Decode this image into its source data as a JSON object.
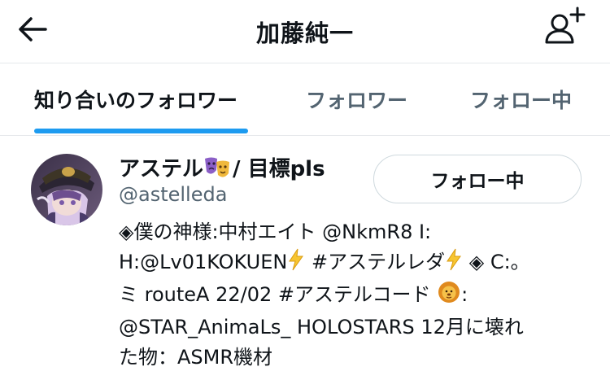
{
  "header": {
    "title": "加藤純一",
    "back_icon": "arrow-left-icon",
    "add_icon": "add-user-icon"
  },
  "tabs": [
    {
      "label": "知り合いのフォロワー",
      "active": true
    },
    {
      "label": "フォロワー",
      "active": false
    },
    {
      "label": "フォロー中",
      "active": false
    }
  ],
  "colors": {
    "accent": "#1d9bf0",
    "text_primary": "#0f1419",
    "text_secondary": "#536471",
    "divider": "#e6e9ec"
  },
  "user": {
    "name_prefix": "アステル",
    "name_suffix": " / 目標pls",
    "handle": "@astelleda",
    "follow_label": "フォロー中",
    "bio_lines": [
      "◈僕の神様:中村エイト @NkmR8 I:",
      "H:@Lv01KOKUEN",
      "#アステルレダ",
      "◈ C:。",
      "ミ routeA 22/02 #アステルコード",
      ":",
      "@STAR_AnimaLs_ HOLOSTARS 12月に壊れ",
      "た物：ASMR機材"
    ]
  }
}
